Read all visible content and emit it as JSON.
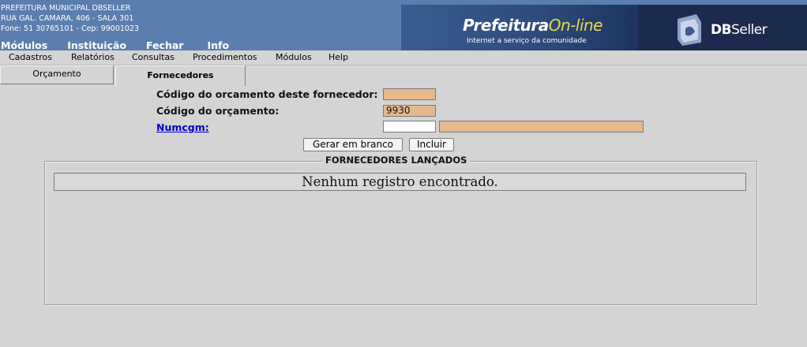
{
  "header": {
    "org_name": "PREFEITURA MUNICIPAL DBSELLER",
    "address": "RUA GAL. CAMARA, 406 - SALA 301",
    "phone": "Fone: 51 30765101  -  Cep: 99001023",
    "menu": [
      "Módulos",
      "Instituição",
      "Fechar",
      "Info"
    ],
    "banner_logo_main": "Prefeitura",
    "banner_logo_accent": "On-line",
    "banner_tagline": "Internet a serviço da comunidade",
    "brand_bold": "DB",
    "brand_light": "Seller"
  },
  "menubar": [
    "Cadastros",
    "Relatórios",
    "Consultas",
    "Procedimentos",
    "Módulos",
    "Help"
  ],
  "tabs": [
    {
      "label": "Orçamento",
      "active": false
    },
    {
      "label": "Fornecedores",
      "active": true
    }
  ],
  "form": {
    "codigo_fornecedor_label": "Código do orcamento deste fornecedor:",
    "codigo_fornecedor_value": "",
    "codigo_orcamento_label": "Código do orçamento:",
    "codigo_orcamento_value": "9930",
    "numcgm_label": "Numcgm:",
    "numcgm_value": "",
    "numcgm_name_value": ""
  },
  "buttons": {
    "gerar": "Gerar em branco",
    "incluir": "Incluir"
  },
  "fornecedores": {
    "legend": "FORNECEDORES LANÇADOS",
    "empty_message": "Nenhum registro encontrado."
  },
  "colors": {
    "header_bg": "#5a7fae",
    "readonly_field": "#e5b98c",
    "page_bg": "#d4d4d4"
  }
}
